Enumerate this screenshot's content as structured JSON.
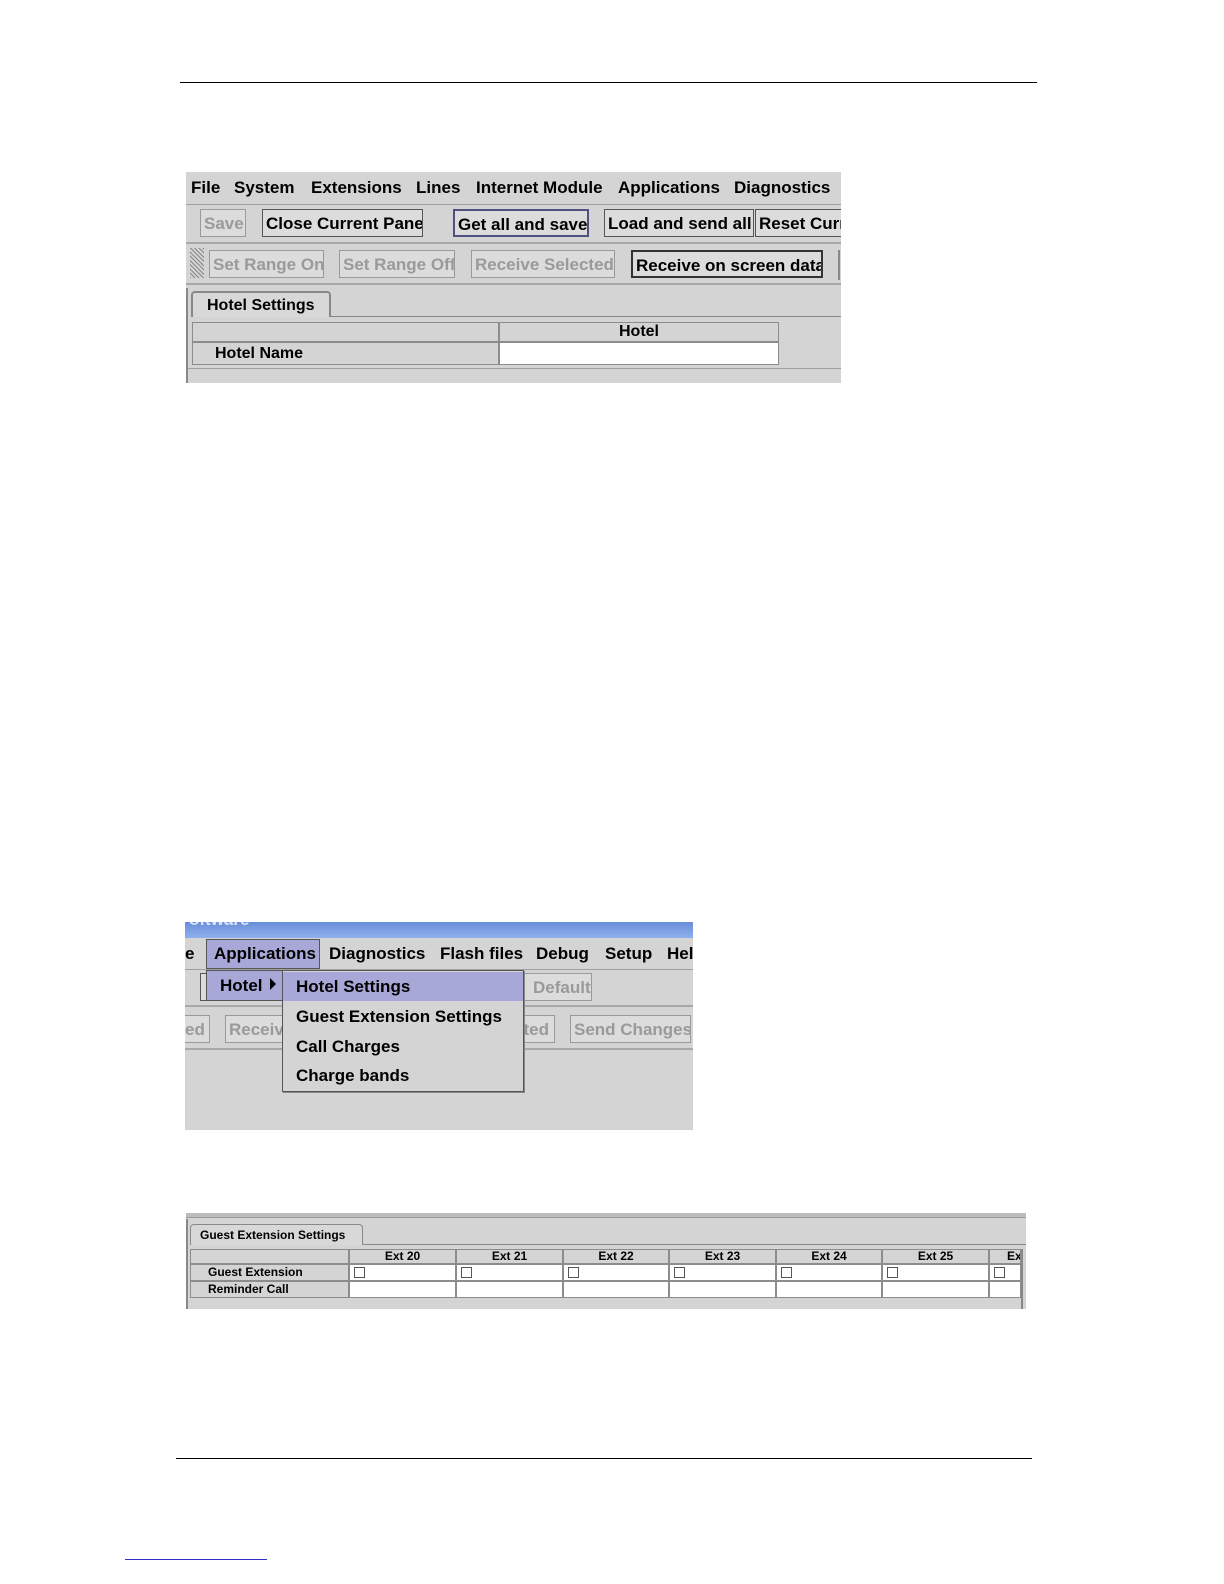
{
  "shot1": {
    "menu": [
      "File",
      "System",
      "Extensions",
      "Lines",
      "Internet Module",
      "Applications",
      "Diagnostics"
    ],
    "toolbar1": [
      "Save",
      "Close Current Pane",
      "Get all and save!",
      "Load and send all!",
      "Reset Curr"
    ],
    "toolbar2": [
      "Set Range On",
      "Set Range Off",
      "Receive Selected",
      "Receive on screen data"
    ],
    "tab": "Hotel Settings",
    "table": {
      "column": "Hotel",
      "row_label": "Hotel Name",
      "row_value": ""
    }
  },
  "shot2": {
    "title_fragment": "oftware",
    "menu": [
      "e",
      "Applications",
      "Diagnostics",
      "Flash files",
      "Debug",
      "Setup",
      "Hel"
    ],
    "submenu_parent": "Hotel",
    "submenu_items": [
      "Hotel Settings",
      "Guest Extension Settings",
      "Call Charges",
      "Charge bands"
    ],
    "bg_fragments": [
      "Default",
      "ed",
      "Receiv",
      "cted",
      "Send Changes"
    ],
    "colors": {
      "title_bar": "#7f9fdb",
      "highlight": "#a8a8d8"
    }
  },
  "shot3": {
    "tab": "Guest Extension Settings",
    "columns": [
      "Ext 20",
      "Ext 21",
      "Ext 22",
      "Ext 23",
      "Ext 24",
      "Ext 25",
      "Ex"
    ],
    "rows": [
      {
        "label": "Guest Extension",
        "type": "checkbox"
      },
      {
        "label": "Reminder Call",
        "type": "text"
      }
    ]
  }
}
